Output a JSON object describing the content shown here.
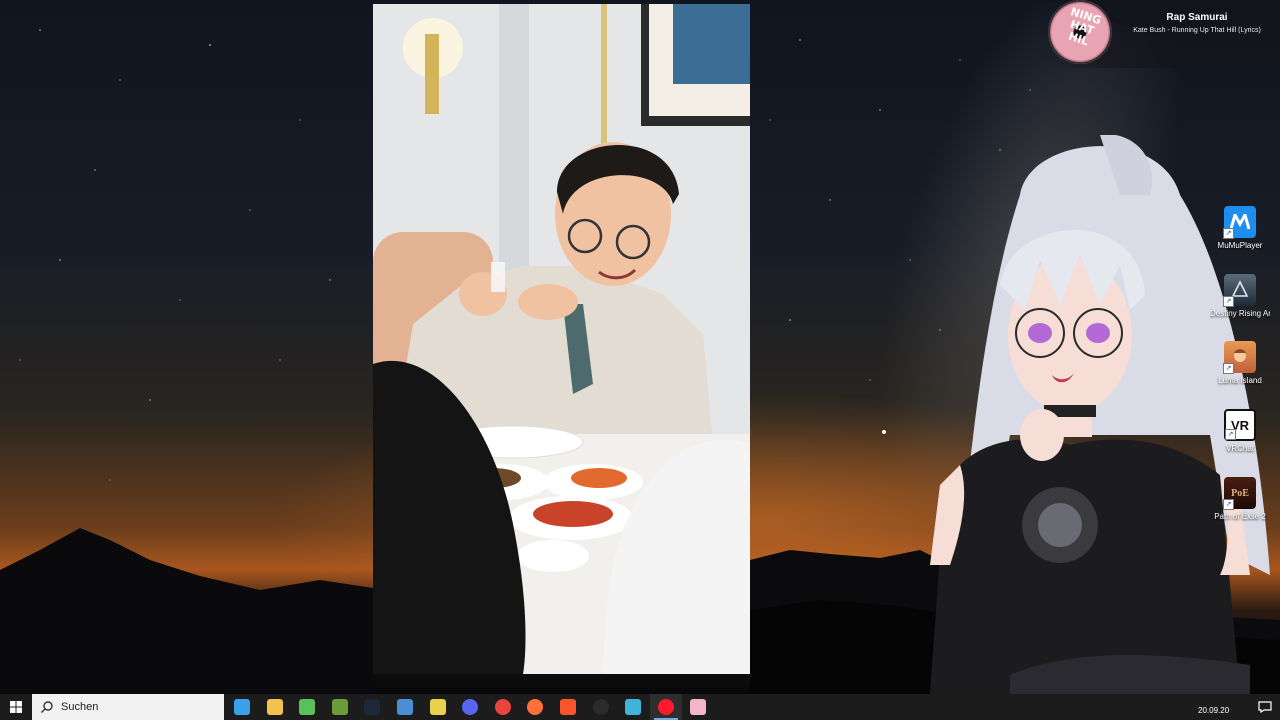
{
  "now_playing": {
    "title": "Rap Samurai",
    "track": "Kate Bush - Running Up That Hill (Lyrics)",
    "art_text": "NING HAT HIL"
  },
  "desktop_icons": [
    {
      "label": "MuMuPlayer",
      "icon": "mumu-player-icon"
    },
    {
      "label": "Destiny Rising Andro...",
      "icon": "destiny-rising-icon"
    },
    {
      "label": "Luma Island",
      "icon": "luma-island-icon"
    },
    {
      "label": "VRChat",
      "icon": "vrchat-icon",
      "icon_text": "VR"
    },
    {
      "label": "Path of Exile 2",
      "icon": "path-of-exile-icon",
      "icon_text": "PoE"
    }
  ],
  "taskbar": {
    "search_placeholder": "Suchen",
    "apps": [
      {
        "name": "microsoft-store",
        "color": "#3aa0e8"
      },
      {
        "name": "file-explorer",
        "color": "#f2c14e"
      },
      {
        "name": "app-green",
        "color": "#5ac05a"
      },
      {
        "name": "minecraft",
        "color": "#6b9c3a"
      },
      {
        "name": "steam",
        "color": "#1b2838"
      },
      {
        "name": "window-app",
        "color": "#4a8fd6"
      },
      {
        "name": "shield-app",
        "color": "#e8d24a"
      },
      {
        "name": "discord",
        "color": "#5865f2"
      },
      {
        "name": "chrome",
        "color": "#e8453c"
      },
      {
        "name": "firefox",
        "color": "#ff7139"
      },
      {
        "name": "brave",
        "color": "#fb542b"
      },
      {
        "name": "obs",
        "color": "#2b2b2b"
      },
      {
        "name": "app-teal",
        "color": "#3fb4d8"
      },
      {
        "name": "opera",
        "color": "#ff1b2d"
      },
      {
        "name": "vtuber-app",
        "color": "#f3b6c8"
      }
    ],
    "active_app_index": 13,
    "clock": "20.09.20"
  },
  "colors": {
    "taskbar_bg": "#1c1c1c",
    "search_bg": "#f2f2f2",
    "accent": "#7aa7e0"
  }
}
